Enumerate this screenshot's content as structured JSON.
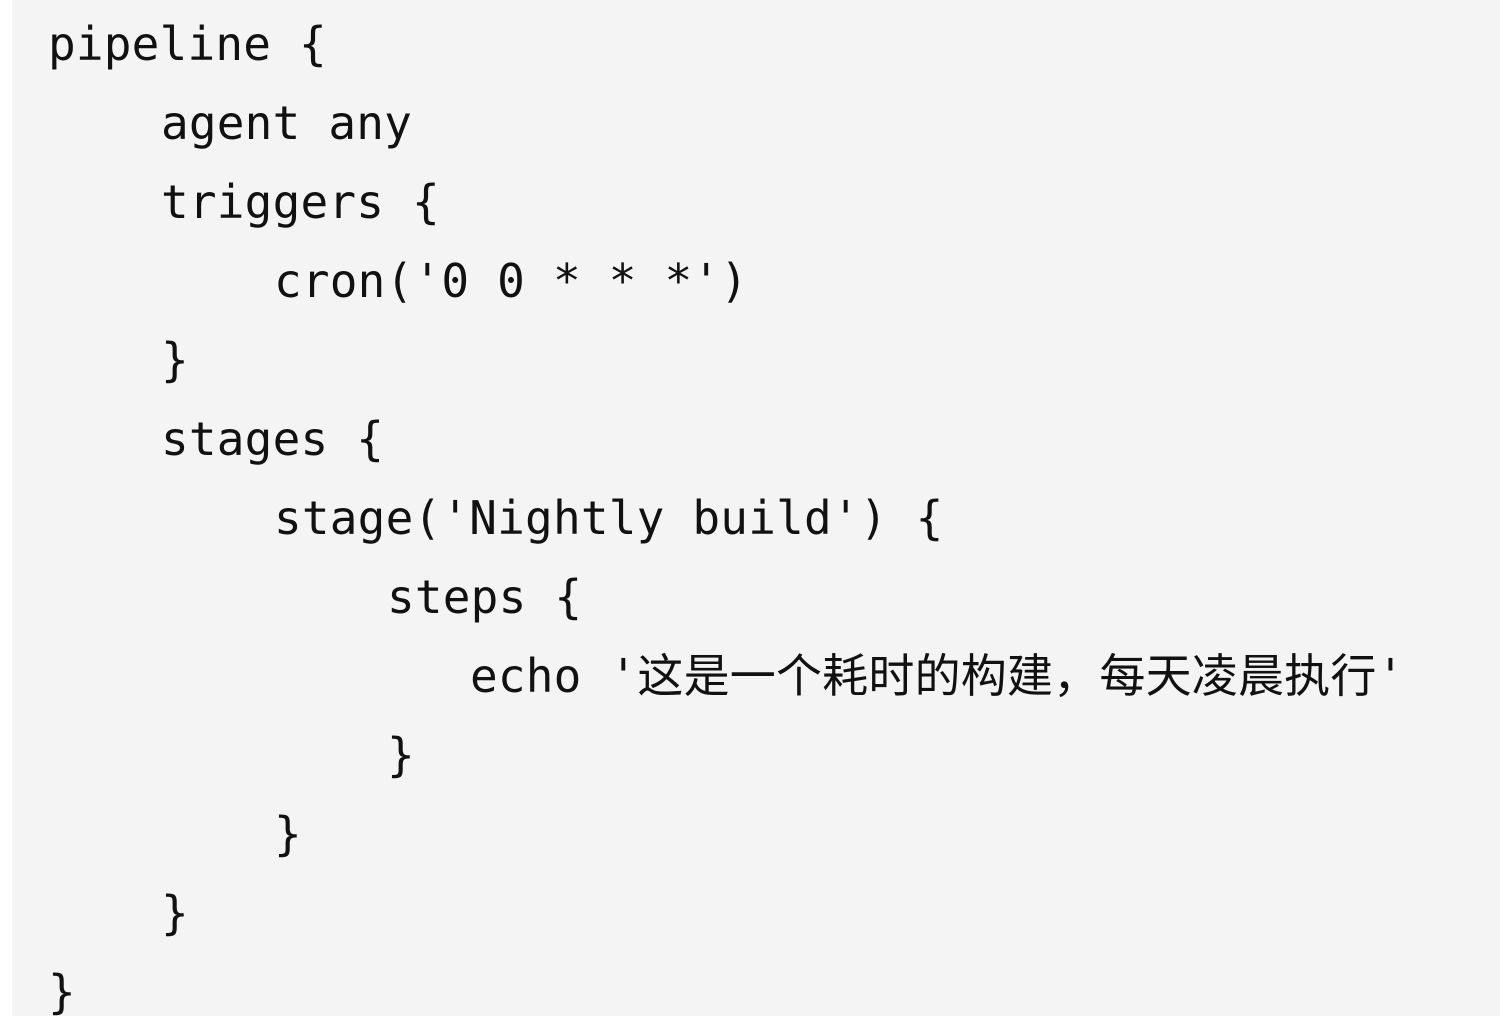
{
  "code": {
    "lines": [
      "pipeline {",
      "agent any",
      "triggers {",
      "cron('0 0 * * *')",
      "}",
      "stages {",
      "stage('Nightly build') {",
      "steps {",
      "echo '这是一个耗时的构建，每天凌晨执行'",
      "}",
      "}",
      "}",
      "}"
    ]
  }
}
